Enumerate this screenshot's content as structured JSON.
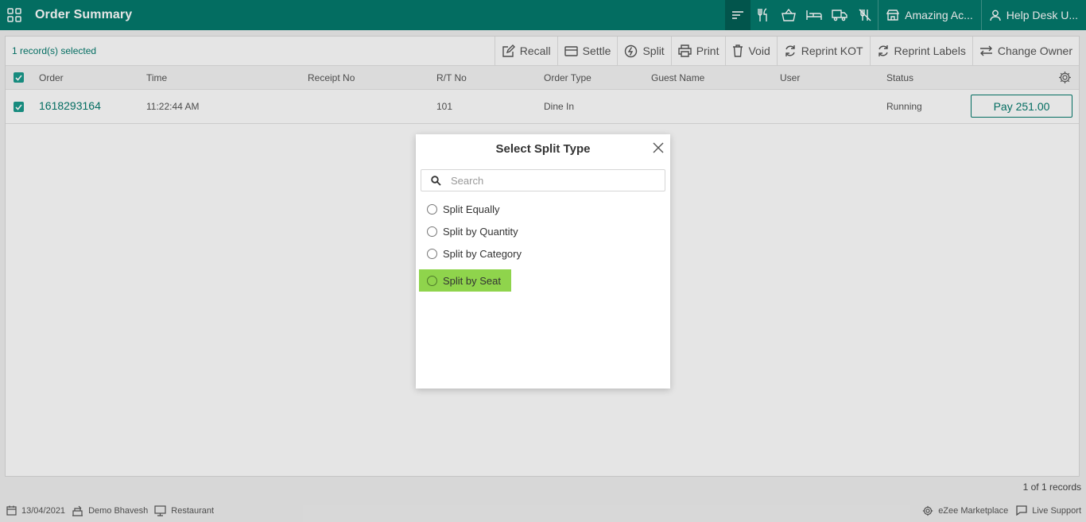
{
  "app": {
    "title": "Order Summary"
  },
  "topbar": {
    "outlet_label": "Amazing Ac...",
    "user_label": "Help Desk U..."
  },
  "toolbar": {
    "selected_text": "1 record(s) selected",
    "recall": "Recall",
    "settle": "Settle",
    "split": "Split",
    "print": "Print",
    "void": "Void",
    "reprint_kot": "Reprint KOT",
    "reprint_labels": "Reprint Labels",
    "change_owner": "Change Owner"
  },
  "table": {
    "columns": {
      "order": "Order",
      "time": "Time",
      "receipt_no": "Receipt No",
      "rt_no": "R/T No",
      "order_type": "Order Type",
      "guest_name": "Guest Name",
      "user": "User",
      "status": "Status"
    },
    "rows": [
      {
        "order": "1618293164",
        "time": "11:22:44 AM",
        "receipt_no": "",
        "rt_no": "101",
        "order_type": "Dine In",
        "guest_name": "",
        "user": "",
        "status": "Running",
        "pay_label": "Pay 251.00"
      }
    ]
  },
  "footer": {
    "records": "1 of 1 records",
    "date": "13/04/2021",
    "user": "Demo Bhavesh",
    "terminal": "Restaurant",
    "marketplace": "eZee Marketplace",
    "support": "Live Support"
  },
  "modal": {
    "title": "Select Split Type",
    "search_placeholder": "Search",
    "options": [
      {
        "label": "Split Equally"
      },
      {
        "label": "Split by Quantity"
      },
      {
        "label": "Split by Category"
      },
      {
        "label": "Split by Seat",
        "highlighted": true
      }
    ]
  },
  "colors": {
    "primary": "#047a6d",
    "highlight": "#8fd44c"
  }
}
